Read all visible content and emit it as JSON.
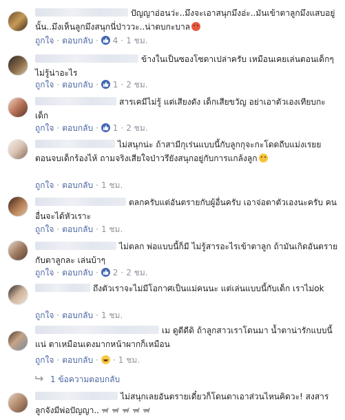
{
  "labels": {
    "like": "ถูกใจ",
    "reply": "ตอบกลับ",
    "sep": "·"
  },
  "comments": [
    {
      "text": "ปัญญาอ่อนว่ะ..มึงจะเอาสนุกมึงอ่ะ..มันเข้าตาลูกมึงแสบอยู่นั้น..มึงเห็นลูกมึงสนุกนี่ป่าววะ..น่าตบกะบาล",
      "likes": "4",
      "time": "1 ชม.",
      "emoji": "angry-face-icon"
    },
    {
      "text": "ข้างในเป็นซองโซดาเปล่าครับ เหมือนเคยเล่นตอนเด็กๆ ไม่รู้น่าอะไร",
      "likes": "1",
      "time": "2 ชม."
    },
    {
      "text": "สารเคมีไม่รู้ แต่เสียงดัง เด็กเสียขวัญ อย่าเอาตัวเองเทียบกะเด็ก",
      "likes": "1",
      "time": "2 ชม."
    },
    {
      "text": "ไม่สนุกน่ะ ถ้าสามีกุเร่นแบบนี้กับลูกกุจะกะโดดถีบแม่งเรยย ตอนจบเด็กร้องไห้ ถามจริงเสียใจป่าวรึยังสนุกอยู่กับการแกล้งลูก",
      "likes": "",
      "time": "1 ชม.",
      "emoji": "expressionless-face-icon"
    },
    {
      "text": "ตลกครับแต่อันตรายกับผู้อื่นครับ เอาจ่อตาตัวเองนะครับ คนอื่นจะได้หัวเราะ",
      "likes": "",
      "time": "1 ชม."
    },
    {
      "text": "ไม่ตลก พ่อแบบนี้ก็มี ไม่รู้สารอะไรเข้าตาลูก ถ้ามันเกิดอันตรายกับตาลูกละ เล่นบ้าๆ",
      "likes": "2",
      "time": "2 ชม."
    },
    {
      "text": "ถึงตัวเราจะไม่มีโอกาศเป็นแม่คนนะ แต่เล่นแบบนี้กับเด็ก เราไม่ok",
      "likes": "",
      "time": "1 ชม."
    },
    {
      "text": "เม ดูดีดีดิ ถ้าลูกสาวเราโดนมา น้ำตาน่ารักแบบนี้แน่ ตาเหมือนเดงมากหน้าผากก็เหมือน",
      "likes": "",
      "time": "1 ชม.",
      "reaction": "haha"
    },
    {
      "text": "ไม่สนุกเลยอันตรายเดี๋ยวก็โดนตาเอาส่วนไหนคิดวะ! สงสารลูกจังมีพ่อปัญญา..",
      "likes": "",
      "time": ""
    }
  ],
  "replies_link": "1 ข้อความตอบกลับ",
  "icons": {
    "like": "thumbs-up-icon",
    "haha": "laughing-face-icon",
    "replies": "reply-arrow-icon",
    "goat": "goat-icon"
  },
  "colors": {
    "link": "#4b67a1",
    "meta": "#90949c",
    "text": "#1c1e21",
    "like_blue": "#4267b2"
  }
}
